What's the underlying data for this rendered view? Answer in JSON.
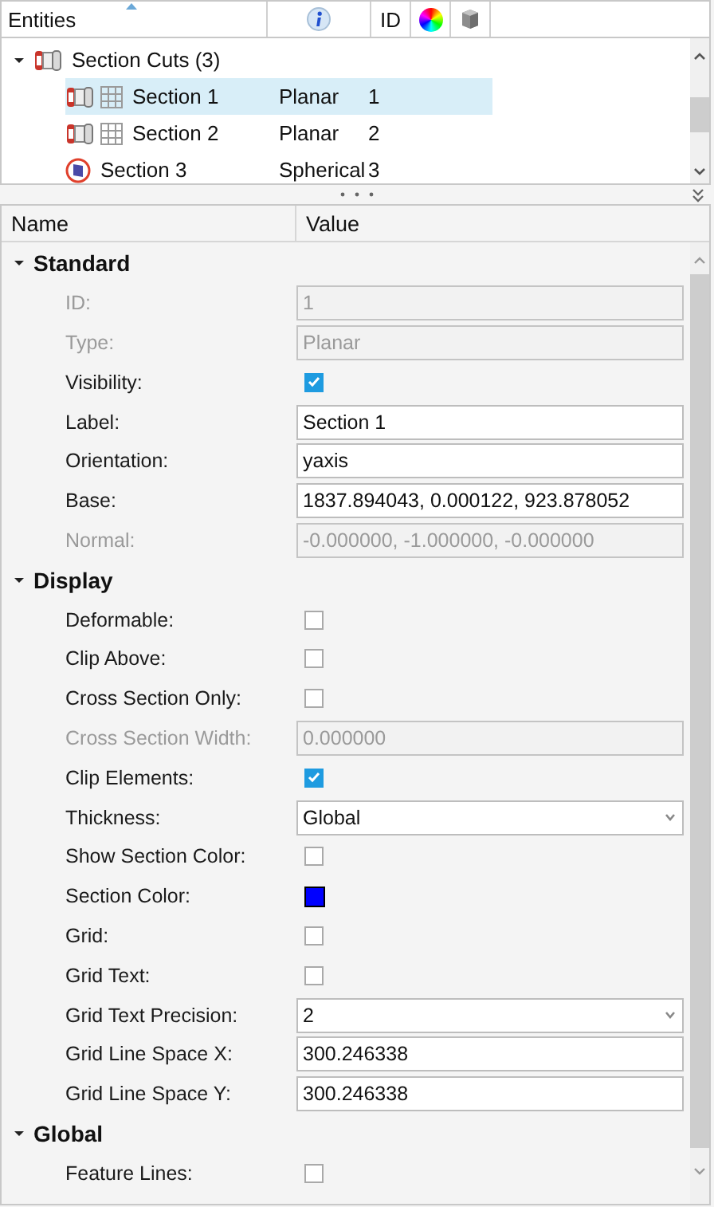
{
  "entities": {
    "columns": [
      {
        "kind": "text",
        "label": "Entities",
        "sorted": true
      },
      {
        "kind": "info"
      },
      {
        "kind": "text",
        "label": "ID",
        "sorted": false
      },
      {
        "kind": "color"
      },
      {
        "kind": "cube"
      }
    ],
    "tree": [
      {
        "label": "Section Cuts (3)",
        "expanded": true,
        "children": [
          {
            "kind": "planar",
            "name": "Section 1",
            "type": "Planar",
            "id": "1",
            "selected": true
          },
          {
            "kind": "planar",
            "name": "Section 2",
            "type": "Planar",
            "id": "2",
            "selected": false
          },
          {
            "kind": "spherical",
            "name": "Section 3",
            "type": "Spherical",
            "id": "3",
            "selected": false
          }
        ]
      }
    ]
  },
  "properties": {
    "columns": [
      "Name",
      "Value"
    ],
    "groups": [
      {
        "title": "Standard",
        "expanded": true,
        "rows": [
          {
            "kind": "text",
            "label": "ID:",
            "value": "1",
            "disabled": true
          },
          {
            "kind": "text",
            "label": "Type:",
            "value": "Planar",
            "disabled": true
          },
          {
            "kind": "checkbox",
            "label": "Visibility:",
            "checked": true,
            "disabled": false
          },
          {
            "kind": "text",
            "label": "Label:",
            "value": "Section 1",
            "disabled": false
          },
          {
            "kind": "text",
            "label": "Orientation:",
            "value": "yaxis",
            "disabled": false
          },
          {
            "kind": "text",
            "label": "Base:",
            "value": "1837.894043, 0.000122, 923.878052",
            "disabled": false
          },
          {
            "kind": "text",
            "label": "Normal:",
            "value": "-0.000000, -1.000000, -0.000000",
            "disabled": true
          }
        ]
      },
      {
        "title": "Display",
        "expanded": true,
        "rows": [
          {
            "kind": "checkbox",
            "label": "Deformable:",
            "checked": false,
            "disabled": false
          },
          {
            "kind": "checkbox",
            "label": "Clip Above:",
            "checked": false,
            "disabled": false
          },
          {
            "kind": "checkbox",
            "label": "Cross Section Only:",
            "checked": false,
            "disabled": false
          },
          {
            "kind": "text",
            "label": "Cross Section Width:",
            "value": "0.000000",
            "disabled": true
          },
          {
            "kind": "checkbox",
            "label": "Clip Elements:",
            "checked": true,
            "disabled": false
          },
          {
            "kind": "select",
            "label": "Thickness:",
            "value": "Global",
            "disabled": false
          },
          {
            "kind": "checkbox",
            "label": "Show Section Color:",
            "checked": false,
            "disabled": false
          },
          {
            "kind": "color",
            "label": "Section Color:",
            "color": "#0000ff",
            "disabled": false
          },
          {
            "kind": "checkbox",
            "label": "Grid:",
            "checked": false,
            "disabled": false
          },
          {
            "kind": "checkbox",
            "label": "Grid Text:",
            "checked": false,
            "disabled": false
          },
          {
            "kind": "select",
            "label": "Grid Text Precision:",
            "value": "2",
            "disabled": false
          },
          {
            "kind": "text",
            "label": "Grid Line Space X:",
            "value": "300.246338",
            "disabled": false
          },
          {
            "kind": "text",
            "label": "Grid Line Space Y:",
            "value": "300.246338",
            "disabled": false
          }
        ]
      },
      {
        "title": "Global",
        "expanded": true,
        "rows": [
          {
            "kind": "checkbox",
            "label": "Feature Lines:",
            "checked": false,
            "disabled": false
          }
        ]
      }
    ]
  }
}
